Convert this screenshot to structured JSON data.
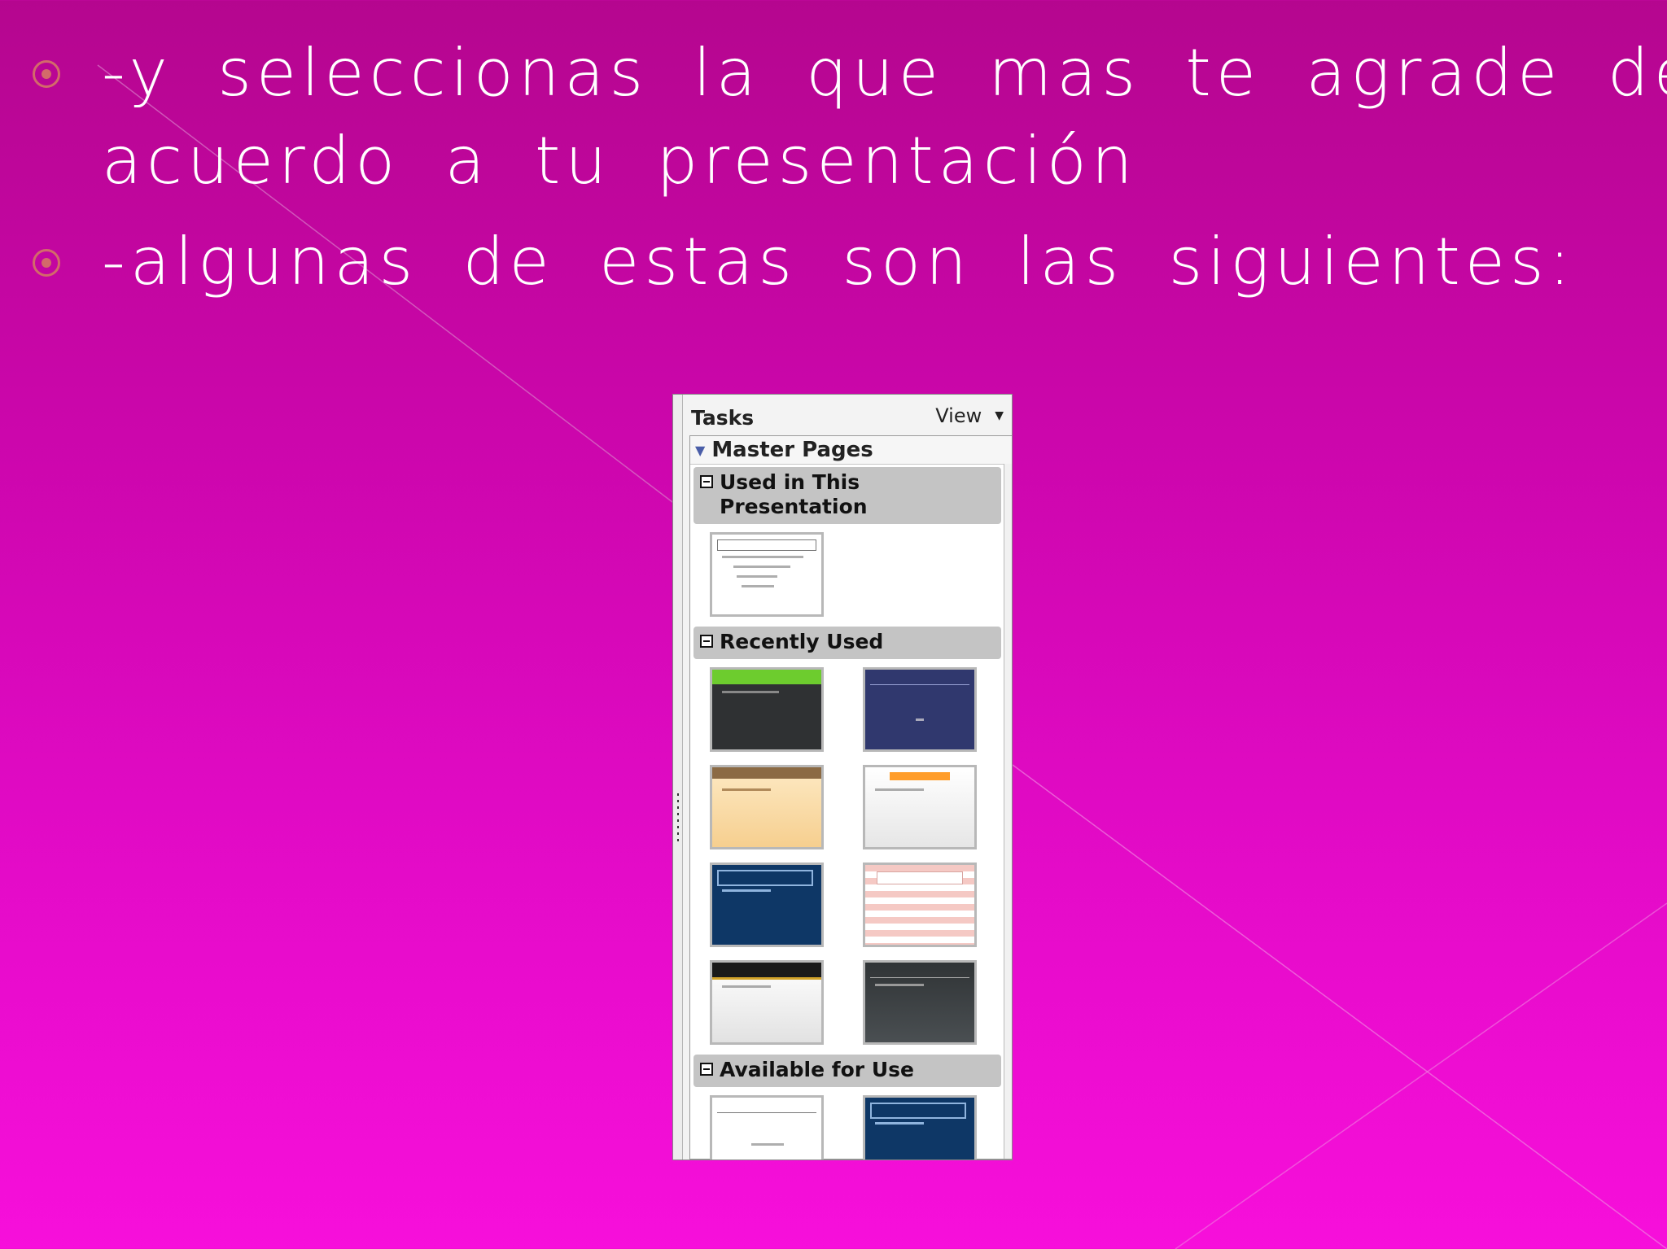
{
  "slide": {
    "bullets": [
      {
        "line1": "-y seleccionas la que mas te agrade de",
        "line2": "acuerdo a tu presentación"
      },
      {
        "line1": "-algunas de estas son las siguientes:"
      }
    ],
    "colors": {
      "background_top": "#b5068f",
      "background_bottom": "#f70fdb",
      "bullet": "#d36a6a",
      "text": "#ffffff"
    }
  },
  "task_pane": {
    "title": "Tasks",
    "view_label": "View",
    "panel_title": "Master Pages",
    "sections": {
      "used": "Used in This Presentation",
      "recent": "Recently Used",
      "available": "Available for Use"
    },
    "thumbnail_styles": {
      "used": [
        "default"
      ],
      "recent": [
        "green",
        "navy",
        "beige",
        "white-orange",
        "blue",
        "striped",
        "black-gold",
        "dark-grey"
      ],
      "available": [
        "default",
        "blue"
      ]
    }
  }
}
